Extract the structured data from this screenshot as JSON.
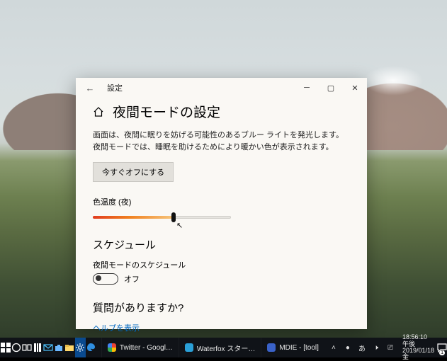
{
  "window": {
    "app_name": "設定",
    "title": "夜間モードの設定",
    "description": "画面は、夜間に眠りを妨げる可能性のあるブルー ライトを発光します。夜間モードでは、睡眠を助けるためにより暖かい色が表示されます。",
    "turn_off_now": "今すぐオフにする",
    "color_temp_label": "色温度 (夜)",
    "schedule_heading": "スケジュール",
    "schedule_label": "夜間モードのスケジュール",
    "schedule_state": "オフ",
    "question_heading": "質問がありますか?",
    "help_link": "ヘルプを表示"
  },
  "taskbar": {
    "tasks": [
      {
        "label": "Twitter - Googl…",
        "color": "#ffffff"
      },
      {
        "label": "Waterfox スター…",
        "color": "#2aa0d8"
      },
      {
        "label": "MDIE - [tool]",
        "color": "#3a62c9"
      }
    ],
    "clock": {
      "time": "18:56:10 午後",
      "date": "2019/01/18 金"
    },
    "badge": "1"
  }
}
